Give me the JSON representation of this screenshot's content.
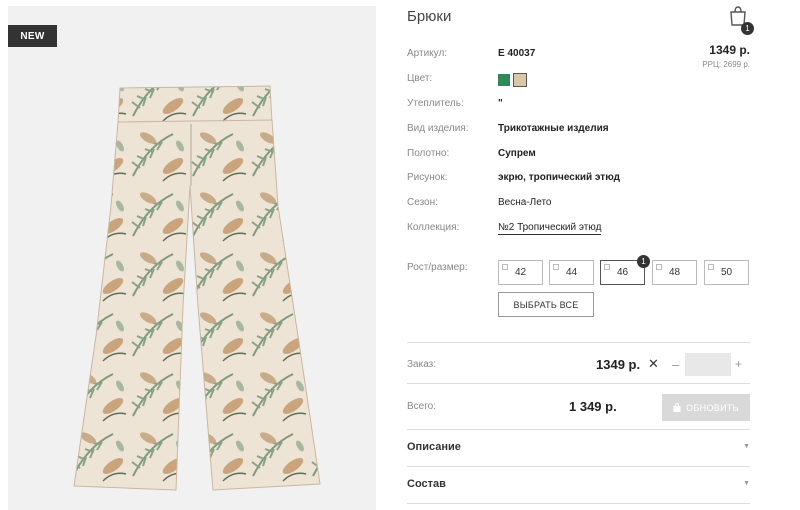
{
  "badge": {
    "new": "NEW"
  },
  "product": {
    "title": "Брюки",
    "price": "1349 р.",
    "rrp": "РРЦ: 2699 р."
  },
  "cart": {
    "count": "1",
    "icon": "shopping-bag-icon"
  },
  "details": {
    "article": {
      "label": "Артикул:",
      "value": "Е 40037"
    },
    "color": {
      "label": "Цвет:",
      "swatches": [
        "#2e8b57",
        "#d9c7a8"
      ]
    },
    "insulation": {
      "label": "Утеплитель:",
      "value": "\""
    },
    "type": {
      "label": "Вид изделия:",
      "value": "Трикотажные изделия"
    },
    "fabric": {
      "label": "Полотно:",
      "value": "Супрем"
    },
    "pattern": {
      "label": "Рисунок:",
      "value": "экрю, тропический этюд"
    },
    "season": {
      "label": "Сезон:",
      "value": "Весна-Лето"
    },
    "collection": {
      "label": "Коллекция:",
      "value": "№2 Тропический этюд"
    }
  },
  "sizes": {
    "label": "Рост/размер:",
    "options": [
      "42",
      "44",
      "46",
      "48",
      "50"
    ],
    "selected": "46",
    "selected_count": "1",
    "select_all": "ВЫБРАТЬ ВСЕ"
  },
  "order": {
    "label": "Заказ:",
    "price": "1349 р.",
    "times": "✕",
    "minus": "–",
    "plus": "+",
    "quantity": ""
  },
  "total": {
    "label": "Всего:",
    "price": "1 349 р.",
    "update": "ОБНОВИТЬ"
  },
  "accordion": {
    "description": "Описание",
    "composition": "Состав"
  }
}
